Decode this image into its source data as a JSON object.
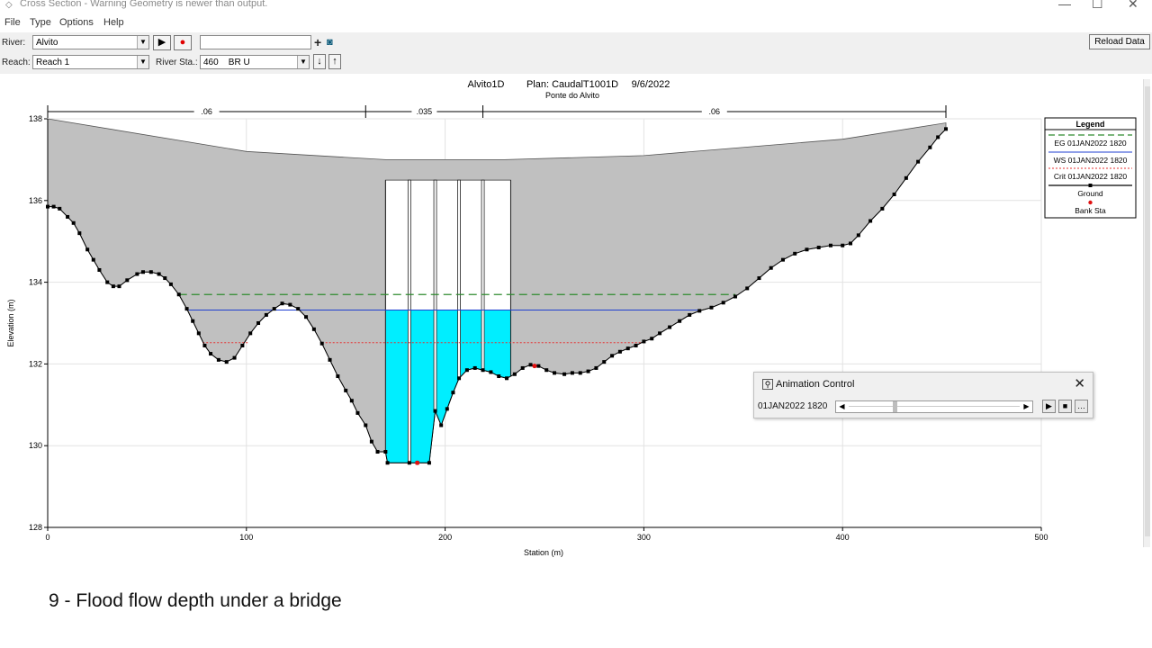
{
  "window": {
    "title": "Cross Section - Warning Geometry is newer than output.",
    "controls": {
      "minimize": "—",
      "maximize": "☐",
      "close": "✕"
    }
  },
  "menu": [
    "File",
    "Type",
    "Options",
    "Help"
  ],
  "toolbar": {
    "river_label": "River:",
    "river_value": "Alvito",
    "reach_label": "Reach:",
    "reach_value": "Reach 1",
    "river_sta_label": "River Sta.:",
    "river_sta_value": "460    BR U",
    "plan_box_value": "",
    "reload_label": "Reload Data"
  },
  "plot": {
    "title_line": [
      "Alvito1D",
      "Plan: CaudalT1001D",
      "9/6/2022"
    ],
    "subtitle": "Ponte do Alvito",
    "xlabel": "Station (m)",
    "ylabel": "Elevation (m)",
    "roughness_labels": [
      ".06",
      ".035",
      ".06"
    ],
    "legend": {
      "title": "Legend",
      "items": [
        "EG 01JAN2022 1820",
        "WS 01JAN2022 1820",
        "Crit 01JAN2022 1820",
        "Ground",
        "Bank Sta"
      ]
    },
    "colors": {
      "eg": "#2e8b2e",
      "ws": "#1f3fd0",
      "crit": "#e53030",
      "water": "#00eeff",
      "deck": "#c0c0c0",
      "ground": "#000000",
      "bank": "#e01010"
    }
  },
  "chart_data": {
    "type": "line",
    "xlim": [
      0,
      500
    ],
    "ylim": [
      128,
      138
    ],
    "x_ticks": [
      0,
      100,
      200,
      300,
      400,
      500
    ],
    "y_ticks": [
      128,
      130,
      132,
      134,
      136,
      138
    ],
    "grid": true,
    "legend_position": "top-right",
    "roughness_breaks": [
      0,
      160,
      219,
      452
    ],
    "eg_elevation": 133.7,
    "ws_elevation": 133.32,
    "crit_elevation": 132.52,
    "bridge": {
      "low_chord": 136.5,
      "left_station": 170,
      "right_station": 233,
      "piers": [
        182,
        195,
        207,
        219
      ]
    },
    "top_of_road": [
      [
        0,
        138.0
      ],
      [
        100,
        137.2
      ],
      [
        170,
        137.0
      ],
      [
        230,
        137.0
      ],
      [
        300,
        137.1
      ],
      [
        400,
        137.5
      ],
      [
        452,
        137.9
      ]
    ],
    "ground": [
      [
        0,
        135.85
      ],
      [
        3,
        135.85
      ],
      [
        6,
        135.8
      ],
      [
        10,
        135.6
      ],
      [
        13,
        135.45
      ],
      [
        16,
        135.2
      ],
      [
        20,
        134.8
      ],
      [
        23,
        134.55
      ],
      [
        26,
        134.3
      ],
      [
        30,
        134.0
      ],
      [
        33,
        133.9
      ],
      [
        36,
        133.9
      ],
      [
        40,
        134.05
      ],
      [
        45,
        134.2
      ],
      [
        48,
        134.25
      ],
      [
        52,
        134.25
      ],
      [
        56,
        134.2
      ],
      [
        59,
        134.1
      ],
      [
        62,
        133.95
      ],
      [
        66,
        133.7
      ],
      [
        70,
        133.35
      ],
      [
        73,
        133.05
      ],
      [
        76,
        132.75
      ],
      [
        79,
        132.45
      ],
      [
        82,
        132.25
      ],
      [
        86,
        132.1
      ],
      [
        90,
        132.05
      ],
      [
        94,
        132.15
      ],
      [
        98,
        132.45
      ],
      [
        102,
        132.75
      ],
      [
        106,
        133.0
      ],
      [
        110,
        133.2
      ],
      [
        114,
        133.35
      ],
      [
        118,
        133.48
      ],
      [
        122,
        133.45
      ],
      [
        126,
        133.35
      ],
      [
        130,
        133.15
      ],
      [
        134,
        132.85
      ],
      [
        138,
        132.5
      ],
      [
        142,
        132.1
      ],
      [
        146,
        131.7
      ],
      [
        150,
        131.35
      ],
      [
        153,
        131.1
      ],
      [
        156,
        130.8
      ],
      [
        160,
        130.5
      ],
      [
        163,
        130.1
      ],
      [
        166,
        129.85
      ],
      [
        170,
        129.85
      ],
      [
        171,
        129.58
      ],
      [
        182,
        129.58
      ],
      [
        186,
        129.58
      ],
      [
        192,
        129.58
      ],
      [
        195,
        130.85
      ],
      [
        198,
        130.5
      ],
      [
        201,
        130.9
      ],
      [
        204,
        131.3
      ],
      [
        207,
        131.65
      ],
      [
        211,
        131.85
      ],
      [
        215,
        131.9
      ],
      [
        219,
        131.85
      ],
      [
        223,
        131.8
      ],
      [
        227,
        131.7
      ],
      [
        231,
        131.65
      ],
      [
        235,
        131.75
      ],
      [
        239,
        131.9
      ],
      [
        243,
        131.98
      ],
      [
        247,
        131.95
      ],
      [
        251,
        131.85
      ],
      [
        255,
        131.78
      ],
      [
        260,
        131.75
      ],
      [
        264,
        131.78
      ],
      [
        268,
        131.78
      ],
      [
        272,
        131.82
      ],
      [
        276,
        131.9
      ],
      [
        280,
        132.05
      ],
      [
        284,
        132.2
      ],
      [
        288,
        132.3
      ],
      [
        292,
        132.38
      ],
      [
        296,
        132.45
      ],
      [
        300,
        132.55
      ],
      [
        304,
        132.62
      ],
      [
        308,
        132.75
      ],
      [
        313,
        132.9
      ],
      [
        318,
        133.05
      ],
      [
        323,
        133.2
      ],
      [
        328,
        133.3
      ],
      [
        334,
        133.38
      ],
      [
        340,
        133.5
      ],
      [
        346,
        133.65
      ],
      [
        352,
        133.85
      ],
      [
        358,
        134.1
      ],
      [
        364,
        134.35
      ],
      [
        370,
        134.55
      ],
      [
        376,
        134.7
      ],
      [
        382,
        134.8
      ],
      [
        388,
        134.85
      ],
      [
        394,
        134.9
      ],
      [
        400,
        134.9
      ],
      [
        404,
        134.95
      ],
      [
        408,
        135.15
      ],
      [
        414,
        135.5
      ],
      [
        420,
        135.8
      ],
      [
        426,
        136.15
      ],
      [
        432,
        136.55
      ],
      [
        438,
        136.95
      ],
      [
        444,
        137.3
      ],
      [
        448,
        137.55
      ],
      [
        452,
        137.75
      ]
    ],
    "bank_stations": [
      [
        186,
        129.58
      ],
      [
        245,
        131.95
      ]
    ]
  },
  "animation": {
    "title": "Animation Control",
    "time": "01JAN2022 1820",
    "position": 0.26
  },
  "caption": "9 - Flood flow depth under a bridge"
}
